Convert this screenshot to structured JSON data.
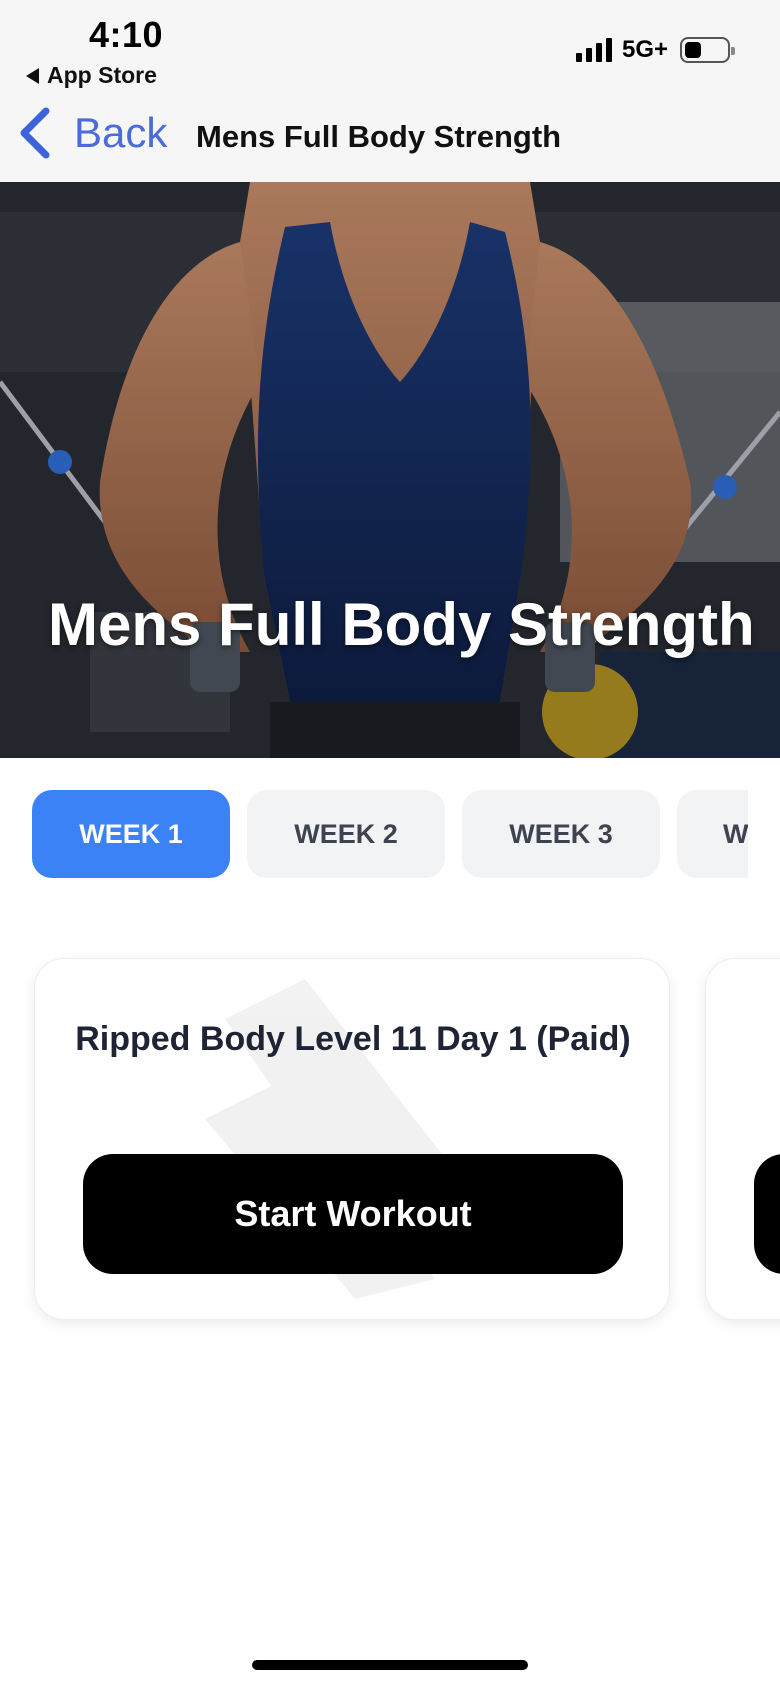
{
  "status_bar": {
    "time": "4:10",
    "back_app": "App Store",
    "network": "5G+"
  },
  "nav": {
    "back_label": "Back",
    "title": "Mens Full Body Strength"
  },
  "hero": {
    "title": "Mens Full Body Strength"
  },
  "weeks": {
    "tabs": [
      {
        "label": "WEEK 1",
        "active": true
      },
      {
        "label": "WEEK 2",
        "active": false
      },
      {
        "label": "WEEK 3",
        "active": false
      },
      {
        "label": "W",
        "active": false
      }
    ]
  },
  "workouts": {
    "cards": [
      {
        "title": "Ripped Body Level 11 Day 1 (Paid)",
        "button": "Start Workout"
      }
    ]
  },
  "colors": {
    "accent": "#3b82f6",
    "back_link": "#4a6bd9",
    "button": "#000000"
  }
}
